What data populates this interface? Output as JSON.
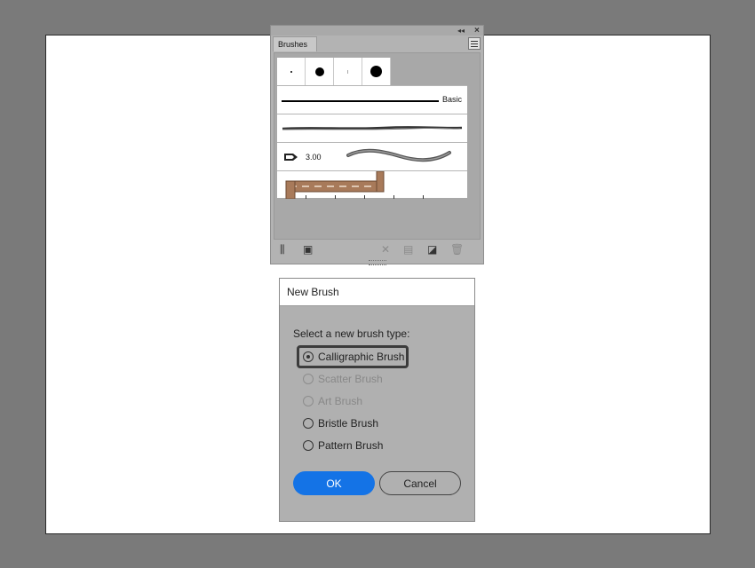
{
  "brushes_panel": {
    "tab_label": "Brushes",
    "rows": {
      "basic_label": "Basic",
      "calligraphic_value": "3.00"
    },
    "icons": [
      "collapse-icon",
      "close-icon",
      "panel-menu-icon",
      "brush-libraries-icon",
      "libraries-panel-icon",
      "remove-stroke-icon",
      "brush-options-icon",
      "new-brush-icon",
      "delete-brush-icon"
    ]
  },
  "dialog": {
    "title": "New Brush",
    "prompt": "Select a new brush type:",
    "options": [
      {
        "label": "Calligraphic Brush",
        "checked": true,
        "enabled": true
      },
      {
        "label": "Scatter Brush",
        "checked": false,
        "enabled": false
      },
      {
        "label": "Art Brush",
        "checked": false,
        "enabled": false
      },
      {
        "label": "Bristle Brush",
        "checked": false,
        "enabled": true
      },
      {
        "label": "Pattern Brush",
        "checked": false,
        "enabled": true
      }
    ],
    "ok_label": "OK",
    "cancel_label": "Cancel"
  },
  "colors": {
    "accent": "#1473e6",
    "canvas_bg": "#7a7a7a",
    "panel_bg": "#b3b3b3",
    "dialog_bg": "#b0b0b0"
  }
}
